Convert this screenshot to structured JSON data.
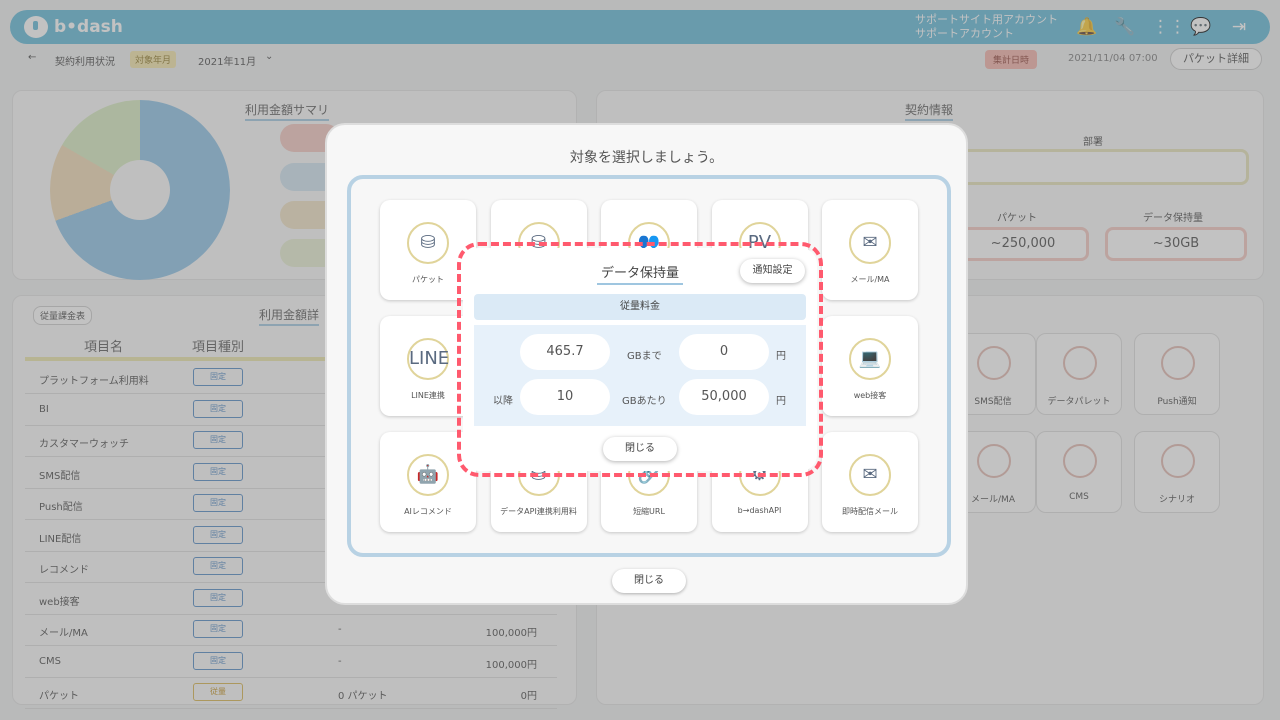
{
  "header": {
    "logo_text": "b•dash",
    "account_line1": "サポートサイト用アカウント",
    "account_line2": "サポートアカウント",
    "icons": [
      "bell-icon",
      "wrench-icon",
      "grid-icon",
      "chat-icon",
      "logout-icon"
    ]
  },
  "subbar": {
    "back": "←",
    "title": "契約利用状況",
    "period_tag": "対象年月",
    "month": "2021年11月",
    "agg_tag": "集計日時",
    "agg_time": "2021/11/04 07:00",
    "packet_detail_button": "パケット詳細"
  },
  "summary": {
    "title": "利用金額サマリ"
  },
  "contract": {
    "title": "契約情報",
    "dept_label": "部署",
    "packet_label": "パケット",
    "packet_value": "~250,000",
    "data_label": "データ保持量",
    "data_value": "~30GB"
  },
  "detail": {
    "tag": "従量課金表",
    "title": "利用金額詳",
    "col_name": "項目名",
    "col_kind": "項目種別",
    "rows": [
      {
        "name": "プラットフォーム利用料",
        "kind": "固定",
        "qty": "",
        "price": ""
      },
      {
        "name": "BI",
        "kind": "固定",
        "qty": "",
        "price": ""
      },
      {
        "name": "カスタマーウォッチ",
        "kind": "固定",
        "qty": "",
        "price": ""
      },
      {
        "name": "SMS配信",
        "kind": "固定",
        "qty": "",
        "price": ""
      },
      {
        "name": "Push配信",
        "kind": "固定",
        "qty": "",
        "price": ""
      },
      {
        "name": "LINE配信",
        "kind": "固定",
        "qty": "",
        "price": ""
      },
      {
        "name": "レコメンド",
        "kind": "固定",
        "qty": "",
        "price": ""
      },
      {
        "name": "web接客",
        "kind": "固定",
        "qty": "",
        "price": ""
      },
      {
        "name": "メール/MA",
        "kind": "固定",
        "qty": "-",
        "price": "100,000円"
      },
      {
        "name": "CMS",
        "kind": "固定",
        "qty": "-",
        "price": "100,000円"
      },
      {
        "name": "パケット",
        "kind": "従量",
        "qty": "0 パケット",
        "price": "0円"
      }
    ]
  },
  "bg_tiles": [
    "SMS配信",
    "データパレット",
    "Push通知",
    "メール/MA",
    "CMS",
    "シナリオ"
  ],
  "middle_modal": {
    "title": "対象を選択しましょう。",
    "tiles": [
      "パケット",
      "データ保持量",
      "顧客",
      "PV",
      "メール/MA",
      "LINE連携",
      "",
      "",
      "",
      "web接客",
      "AIレコメンド",
      "データAPI連携利用料",
      "短縮URL",
      "b→dashAPI",
      "即時配信メール"
    ],
    "close": "閉じる"
  },
  "top_modal": {
    "title": "データ保持量",
    "notify_button": "通知設定",
    "band": "従量料金",
    "row1": {
      "left_label": "",
      "value": "465.7",
      "unit": "GBまで",
      "price": "0",
      "yen": "円"
    },
    "row2": {
      "left_label": "以降",
      "value": "10",
      "unit": "GBあたり",
      "price": "50,000",
      "yen": "円"
    },
    "close": "閉じる"
  }
}
